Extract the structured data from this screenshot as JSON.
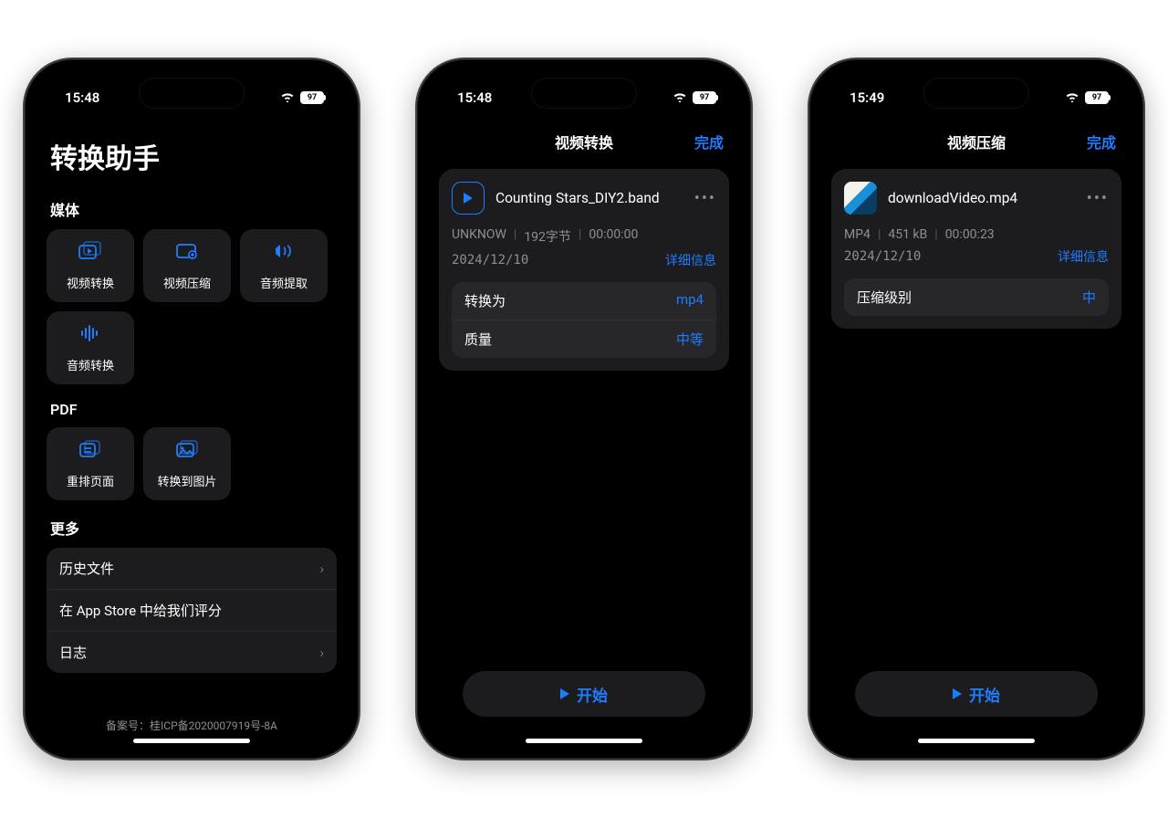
{
  "colors": {
    "accent": "#1e7cff",
    "bg_card": "#1c1c1e",
    "muted": "#8e8e93"
  },
  "status": {
    "time_a": "15:48",
    "time_b": "15:48",
    "time_c": "15:49",
    "battery": "97"
  },
  "screen1": {
    "title": "转换助手",
    "section_media": "媒体",
    "tiles_media": [
      {
        "label": "视频转换"
      },
      {
        "label": "视频压缩"
      },
      {
        "label": "音频提取"
      },
      {
        "label": "音频转换"
      }
    ],
    "section_pdf": "PDF",
    "tiles_pdf": [
      {
        "label": "重排页面"
      },
      {
        "label": "转换到图片"
      }
    ],
    "section_more": "更多",
    "more_items": [
      {
        "label": "历史文件"
      },
      {
        "label": "在 App Store 中给我们评分"
      },
      {
        "label": "日志"
      }
    ],
    "footer": "备案号：桂ICP备2020007919号-8A"
  },
  "screen2": {
    "nav_title": "视频转换",
    "done": "完成",
    "file_name": "Counting Stars_DIY2.band",
    "meta": {
      "format": "UNKNOW",
      "size": "192字节",
      "duration": "00:00:00",
      "date": "2024/12/10"
    },
    "detail": "详细信息",
    "opt_convert_label": "转换为",
    "opt_convert_value": "mp4",
    "opt_quality_label": "质量",
    "opt_quality_value": "中等",
    "start": "开始"
  },
  "screen3": {
    "nav_title": "视频压缩",
    "done": "完成",
    "file_name": "downloadVideo.mp4",
    "meta": {
      "format": "MP4",
      "size": "451 kB",
      "duration": "00:00:23",
      "date": "2024/12/10"
    },
    "detail": "详细信息",
    "opt_level_label": "压缩级别",
    "opt_level_value": "中",
    "start": "开始"
  }
}
